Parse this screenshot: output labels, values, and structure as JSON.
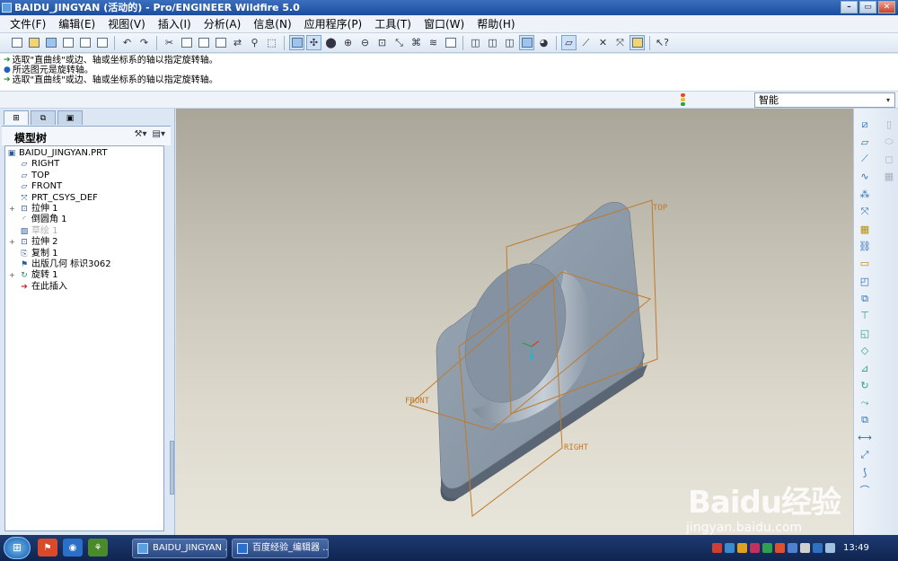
{
  "window": {
    "title": "BAIDU_JINGYAN (活动的) - Pro/ENGINEER Wildfire 5.0",
    "buttons": [
      "minimize",
      "maximize",
      "close"
    ]
  },
  "menubar": {
    "items": [
      "文件(F)",
      "编辑(E)",
      "视图(V)",
      "插入(I)",
      "分析(A)",
      "信息(N)",
      "应用程序(P)",
      "工具(T)",
      "窗口(W)",
      "帮助(H)"
    ]
  },
  "toolbar": {
    "icons": [
      "new-icon",
      "open-icon",
      "save-icon",
      "print-icon",
      "print-preview-icon",
      "email-icon",
      "undo-icon",
      "redo-icon",
      "cut-icon",
      "copy-icon",
      "paste-icon",
      "paste-special-icon",
      "regenerate-icon",
      "find-icon",
      "select-box-icon",
      "datum-display-icon",
      "spin-center-icon",
      "appearance-icon",
      "zoom-in-icon",
      "zoom-out-icon",
      "refit-icon",
      "reorient-icon",
      "saved-views-icon",
      "layers-icon",
      "view-manager-icon",
      "wireframe-icon",
      "hidden-line-icon",
      "no-hidden-icon",
      "shading-icon",
      "enhanced-realism-icon",
      "plane-display-icon",
      "axis-display-icon",
      "point-display-icon",
      "csys-display-icon",
      "annotation-display-icon",
      "context-help-icon"
    ]
  },
  "messages": [
    {
      "type": "prompt",
      "text": "选取\"直曲线\"或边、轴或坐标系的轴以指定旋转轴。"
    },
    {
      "type": "info",
      "text": "所选图元是旋转轴。"
    },
    {
      "type": "prompt",
      "text": "选取\"直曲线\"或边、轴或坐标系的轴以指定旋转轴。"
    }
  ],
  "statusbar": {
    "filter_value": "智能"
  },
  "model_tree": {
    "title": "模型树",
    "nodes": [
      {
        "label": "BAIDU_JINGYAN.PRT",
        "icon": "part-icon",
        "level": 0,
        "expand": "",
        "dim": false
      },
      {
        "label": "RIGHT",
        "icon": "datum-plane-icon",
        "level": 1,
        "expand": "",
        "dim": false
      },
      {
        "label": "TOP",
        "icon": "datum-plane-icon",
        "level": 1,
        "expand": "",
        "dim": false
      },
      {
        "label": "FRONT",
        "icon": "datum-plane-icon",
        "level": 1,
        "expand": "",
        "dim": false
      },
      {
        "label": "PRT_CSYS_DEF",
        "icon": "csys-icon",
        "level": 1,
        "expand": "",
        "dim": false
      },
      {
        "label": "拉伸 1",
        "icon": "extrude-icon",
        "level": 1,
        "expand": "+",
        "dim": false
      },
      {
        "label": "倒圆角 1",
        "icon": "round-icon",
        "level": 1,
        "expand": "",
        "dim": false
      },
      {
        "label": "草绘 1",
        "icon": "sketch-icon",
        "level": 1,
        "expand": "",
        "dim": true
      },
      {
        "label": "拉伸 2",
        "icon": "extrude-icon",
        "level": 1,
        "expand": "+",
        "dim": false
      },
      {
        "label": "复制 1",
        "icon": "copy-feature-icon",
        "level": 1,
        "expand": "",
        "dim": false
      },
      {
        "label": "出版几何 标识3062",
        "icon": "publish-geom-icon",
        "level": 1,
        "expand": "",
        "dim": false
      },
      {
        "label": "旋转 1",
        "icon": "revolve-icon",
        "level": 1,
        "expand": "+",
        "dim": false
      },
      {
        "label": "在此插入",
        "icon": "insert-here-icon",
        "level": 1,
        "expand": "",
        "dim": false
      }
    ]
  },
  "viewport": {
    "datum_labels": {
      "top": "TOP",
      "front": "FRONT",
      "right": "RIGHT"
    }
  },
  "right_toolbar": {
    "icons": [
      "datum-plane-tool-icon",
      "datum-axis-tool-icon",
      "datum-curve-tool-icon",
      "sketch-curve-tool-icon",
      "datum-point-tool-icon",
      "csys-tool-icon",
      "analysis-tool-icon",
      "chain-tool-icon",
      "hole-tool-icon",
      "shell-tool-icon",
      "rib-tool-icon",
      "draft-tool-icon",
      "round-tool-icon",
      "chamfer-tool-icon",
      "extrude-tool-icon",
      "revolve-tool-icon",
      "sweep-tool-icon",
      "blend-tool-icon",
      "mirror-tool-icon",
      "merge-tool-icon",
      "trim-tool-icon",
      "pattern-tool-icon"
    ]
  },
  "taskbar": {
    "tasks": [
      "BAIDU_JINGYAN ...",
      "百度经验_编辑器 ..."
    ],
    "clock": "13:49"
  },
  "watermark": {
    "text": "Baidu经验",
    "url": "jingyan.baidu.com"
  }
}
